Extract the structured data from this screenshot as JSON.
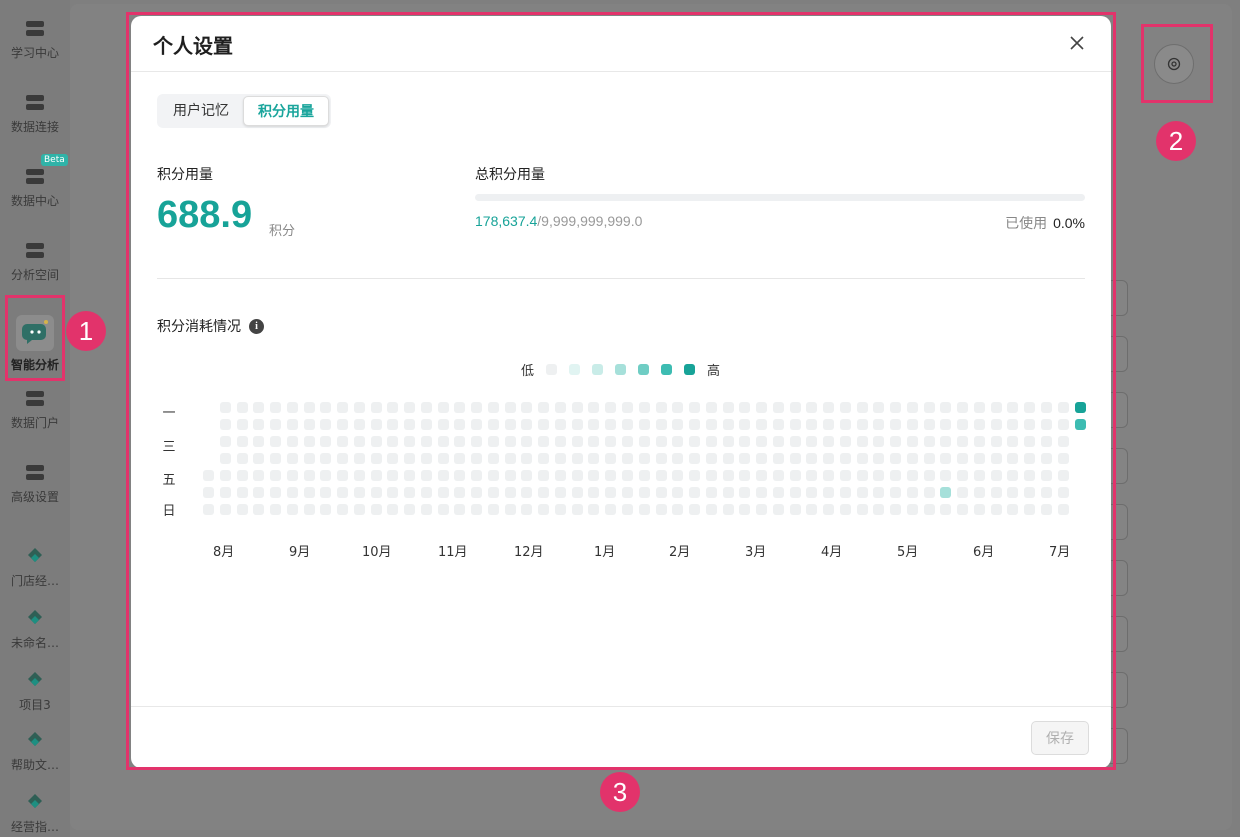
{
  "sidebar": {
    "items": [
      {
        "label": "学习中心",
        "icon": "book-icon"
      },
      {
        "label": "数据连接",
        "icon": "database-link-icon"
      },
      {
        "label": "数据中心",
        "icon": "database-icon",
        "badge": "Beta"
      },
      {
        "label": "分析空间",
        "icon": "analysis-space-icon"
      },
      {
        "label": "智能分析",
        "icon": "ai-chat-icon",
        "active": true
      },
      {
        "label": "数据门户",
        "icon": "bar-chart-icon"
      },
      {
        "label": "高级设置",
        "icon": "gear-icon"
      },
      {
        "label": "门店经…",
        "icon": "project-icon"
      },
      {
        "label": "未命名…",
        "icon": "project-icon"
      },
      {
        "label": "项目3",
        "icon": "project-icon"
      },
      {
        "label": "帮助文…",
        "icon": "project-icon"
      },
      {
        "label": "经营指…",
        "icon": "project-icon"
      }
    ]
  },
  "annotations": [
    "1",
    "2",
    "3"
  ],
  "modal": {
    "title": "个人设置",
    "tabs": [
      {
        "label": "用户记忆",
        "active": false
      },
      {
        "label": "积分用量",
        "active": true
      }
    ],
    "usage": {
      "label": "积分用量",
      "value": "688.9",
      "unit": "积分"
    },
    "total": {
      "label": "总积分用量",
      "used": "178,637.4",
      "max": "/9,999,999,999.0",
      "used_pct_label": "已使用",
      "used_pct": "0.0%",
      "progress_fraction": 0.0
    },
    "consumption": {
      "title": "积分消耗情况",
      "legend_low": "低",
      "legend_high": "高",
      "legend_colors": [
        "#eef0f1",
        "#e1f4f2",
        "#c9ece8",
        "#a6e0da",
        "#6fcdc4",
        "#3dbcb2",
        "#17a398"
      ],
      "day_labels": [
        "一",
        "三",
        "五",
        "日"
      ],
      "months": [
        "8月",
        "9月",
        "10月",
        "11月",
        "12月",
        "1月",
        "2月",
        "3月",
        "4月",
        "5月",
        "6月",
        "7月"
      ],
      "weeks": 53,
      "active_cells": [
        {
          "week": 52,
          "day": 0,
          "level": 6
        },
        {
          "week": 52,
          "day": 1,
          "level": 5
        },
        {
          "week": 44,
          "day": 5,
          "level": 3
        }
      ]
    },
    "save_label": "保存"
  },
  "colors": {
    "accent": "#17a398",
    "annotation": "#e2336b"
  }
}
